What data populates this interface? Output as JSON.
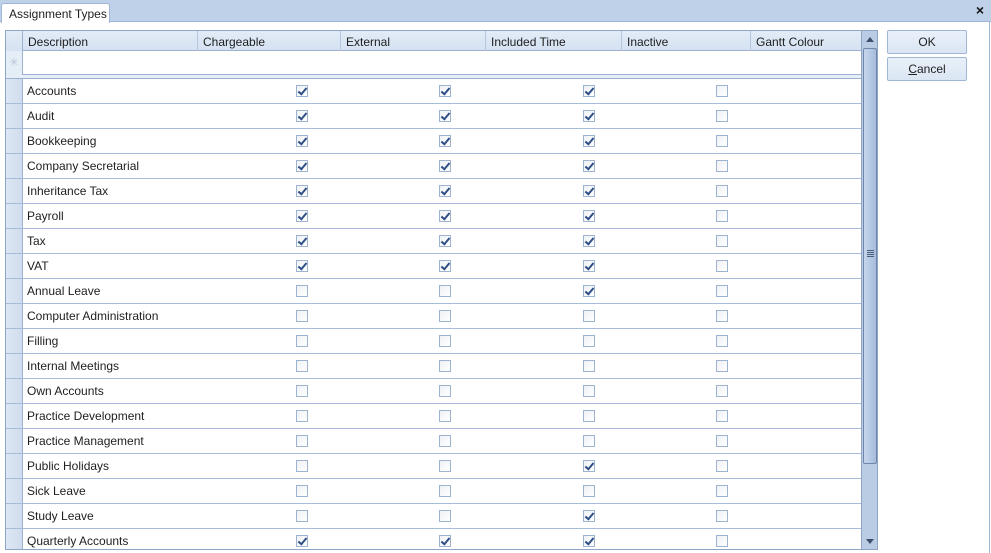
{
  "tab": {
    "label": "Assignment Types"
  },
  "close_label": "×",
  "grid": {
    "columns": [
      {
        "key": "description",
        "label": "Description"
      },
      {
        "key": "chargeable",
        "label": "Chargeable"
      },
      {
        "key": "external",
        "label": "External"
      },
      {
        "key": "included_time",
        "label": "Included Time"
      },
      {
        "key": "inactive",
        "label": "Inactive"
      },
      {
        "key": "gantt_colour",
        "label": "Gantt Colour"
      }
    ],
    "new_row_marker": "✳",
    "rows": [
      {
        "description": "Accounts",
        "chargeable": true,
        "external": true,
        "included_time": true,
        "inactive": false
      },
      {
        "description": "Audit",
        "chargeable": true,
        "external": true,
        "included_time": true,
        "inactive": false
      },
      {
        "description": "Bookkeeping",
        "chargeable": true,
        "external": true,
        "included_time": true,
        "inactive": false
      },
      {
        "description": "Company Secretarial",
        "chargeable": true,
        "external": true,
        "included_time": true,
        "inactive": false
      },
      {
        "description": "Inheritance Tax",
        "chargeable": true,
        "external": true,
        "included_time": true,
        "inactive": false
      },
      {
        "description": "Payroll",
        "chargeable": true,
        "external": true,
        "included_time": true,
        "inactive": false
      },
      {
        "description": "Tax",
        "chargeable": true,
        "external": true,
        "included_time": true,
        "inactive": false
      },
      {
        "description": "VAT",
        "chargeable": true,
        "external": true,
        "included_time": true,
        "inactive": false
      },
      {
        "description": "Annual Leave",
        "chargeable": false,
        "external": false,
        "included_time": true,
        "inactive": false
      },
      {
        "description": "Computer Administration",
        "chargeable": false,
        "external": false,
        "included_time": false,
        "inactive": false
      },
      {
        "description": "Filling",
        "chargeable": false,
        "external": false,
        "included_time": false,
        "inactive": false
      },
      {
        "description": "Internal Meetings",
        "chargeable": false,
        "external": false,
        "included_time": false,
        "inactive": false
      },
      {
        "description": "Own Accounts",
        "chargeable": false,
        "external": false,
        "included_time": false,
        "inactive": false
      },
      {
        "description": "Practice Development",
        "chargeable": false,
        "external": false,
        "included_time": false,
        "inactive": false
      },
      {
        "description": "Practice Management",
        "chargeable": false,
        "external": false,
        "included_time": false,
        "inactive": false
      },
      {
        "description": "Public Holidays",
        "chargeable": false,
        "external": false,
        "included_time": true,
        "inactive": false
      },
      {
        "description": "Sick Leave",
        "chargeable": false,
        "external": false,
        "included_time": false,
        "inactive": false
      },
      {
        "description": "Study Leave",
        "chargeable": false,
        "external": false,
        "included_time": true,
        "inactive": false
      },
      {
        "description": "Quarterly Accounts",
        "chargeable": true,
        "external": true,
        "included_time": true,
        "inactive": false
      }
    ]
  },
  "buttons": {
    "ok": "OK",
    "cancel_mnemonic": "C",
    "cancel_rest": "ancel"
  }
}
